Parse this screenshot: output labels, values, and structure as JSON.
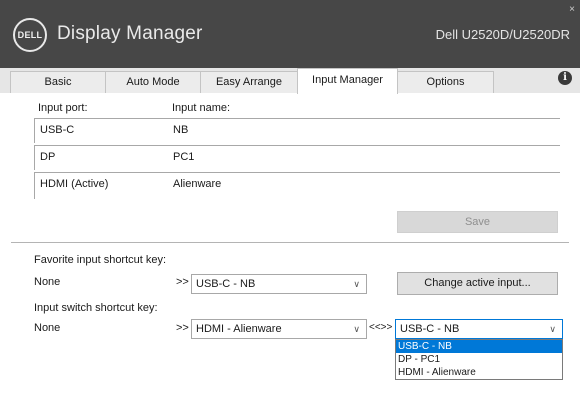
{
  "header": {
    "logo_text": "DELL",
    "app_title": "Display Manager",
    "monitor_name": "Dell U2520D/U2520DR",
    "close_glyph": "×"
  },
  "tabs": [
    {
      "label": "Basic"
    },
    {
      "label": "Auto Mode"
    },
    {
      "label": "Easy Arrange"
    },
    {
      "label": "Input Manager",
      "active": true
    },
    {
      "label": "Options"
    }
  ],
  "info_icon": {
    "glyph": "i",
    "icon": "info-icon"
  },
  "input_table": {
    "col_port": "Input port:",
    "col_name": "Input name:",
    "rows": [
      {
        "port": "USB-C",
        "name": "NB"
      },
      {
        "port": "DP",
        "name": "PC1"
      },
      {
        "port": "HDMI (Active)",
        "name": "Alienware"
      }
    ]
  },
  "save_label": "Save",
  "favorite": {
    "label": "Favorite input shortcut key:",
    "key": "None",
    "arrows": ">>",
    "selected": "USB-C - NB",
    "change_label": "Change active input..."
  },
  "switch": {
    "label": "Input switch shortcut key:",
    "key": "None",
    "arrows": ">>",
    "selected_a": "HDMI - Alienware",
    "swap": "<<>>",
    "selected_b": "USB-C - NB",
    "options": [
      "USB-C - NB",
      "DP - PC1",
      "HDMI - Alienware"
    ]
  },
  "chevron": "∨",
  "colors": {
    "header_bg": "#474747",
    "selection": "#0078d7"
  }
}
